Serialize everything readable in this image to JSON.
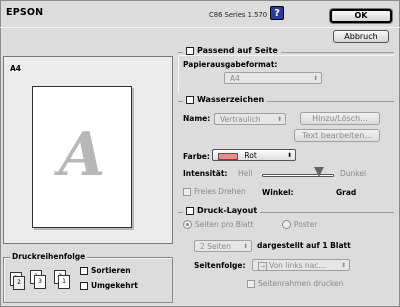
{
  "header": {
    "logo": "EPSON",
    "version": "C86 Series 1.570",
    "help_glyph": "?"
  },
  "buttons": {
    "ok": "OK",
    "cancel": "Abbruch"
  },
  "preview": {
    "paper_size": "A4",
    "watermark_letter": "A"
  },
  "fit_to_page": {
    "title": "Passend auf Seite",
    "output_format_label": "Papierausgabeformat:",
    "output_format_value": "A4"
  },
  "watermark": {
    "title": "Wasserzeichen",
    "name_label": "Name:",
    "name_value": "Vertraulich",
    "add_delete_button": "Hinzu/Lösch...",
    "edit_text_button": "Text bearbeiten...",
    "color_label": "Farbe:",
    "color_value": "Rot",
    "color_hex": "#f08a8a",
    "intensity_label": "Intensität:",
    "intensity_light": "Hell",
    "intensity_dark": "Dunkel",
    "free_rotate_label": "Freies Drehen",
    "angle_label": "Winkel:",
    "angle_unit": "Grad"
  },
  "print_layout": {
    "title": "Druck-Layout",
    "option_pages_per_sheet": "Seiten pro Blatt",
    "option_poster": "Poster",
    "pages_value": "2 Seiten",
    "pages_suffix": "dargestellt auf 1 Blatt",
    "page_order_label": "Seitenfolge:",
    "page_order_value": "Von links nac...",
    "page_border_label": "Seitenrahmen drucken"
  },
  "print_order": {
    "title": "Druckreihenfolge",
    "sort_label": "Sortieren",
    "reverse_label": "Umgekehrt",
    "icon_labels": [
      "1",
      "2",
      "3"
    ]
  }
}
